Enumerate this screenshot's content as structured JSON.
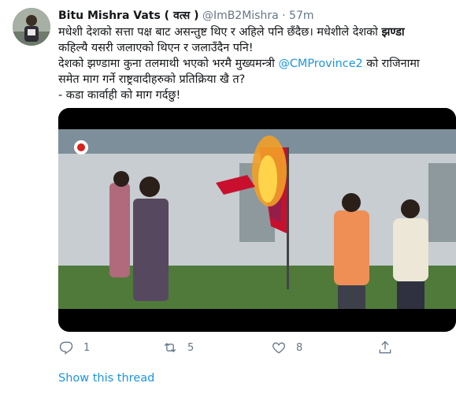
{
  "author": {
    "display_name": "Bitu Mishra Vats ( वत्स )",
    "handle": "@ImB2Mishra",
    "separator": "·",
    "time": "57m"
  },
  "tweet": {
    "line1_a": "मधेशी देशको सत्ता पक्ष बाट असन्तुष्ट थिए र अहिले पनि छँदैछ। मधेशीले देशको ",
    "line1_bold": "झण्डा",
    "line2": "कहिल्यै यसरी जलाएको थिएन र जलाउँदैन  पनि!",
    "line3_a": "देशको झण्डामा कुना तलमाथी भएको भरमै मुख्यमन्त्री ",
    "line3_mention": "@CMProvince2",
    "line3_b": " को राजिनामा",
    "line4": "समेत माग गर्ने राष्ट्रवादीहरुको प्रतिक्रिया खै त?",
    "line5": "- कडा कार्वाही को माग गर्दछु!"
  },
  "actions": {
    "reply_count": "1",
    "retweet_count": "5",
    "like_count": "8"
  },
  "show_thread_label": "Show this thread",
  "colors": {
    "link": "#1b95e0",
    "secondary_text": "#657786",
    "flag_red": "#c8102e",
    "flag_blue": "#1d3a8a"
  }
}
